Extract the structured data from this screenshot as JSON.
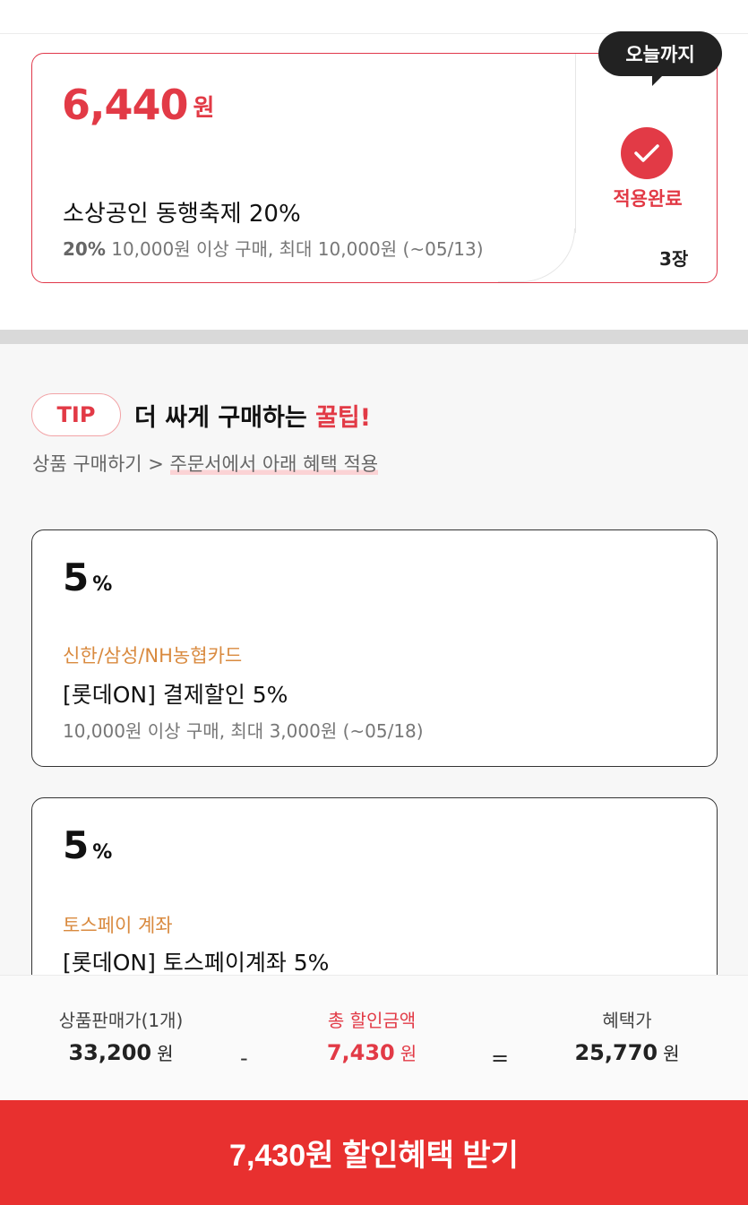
{
  "coupon": {
    "price": "6,440",
    "price_unit": "원",
    "title": "소상공인 동행축제 20%",
    "cond_rate": "20%",
    "cond_text": "10,000원 이상 구매, 최대 10,000원  (~05/13)",
    "today_badge": "오늘까지",
    "status": "적용완료",
    "count": "3장",
    "icons": {
      "check": "check-icon"
    }
  },
  "tip": {
    "badge": "TIP",
    "heading_prefix": "더 싸게 구매하는 ",
    "heading_highlight": "꿀팁!",
    "sub_prefix": "상품 구매하기 > ",
    "sub_highlight": "주문서에서 아래 혜택 적용"
  },
  "benefits": [
    {
      "percent": "5",
      "percent_symbol": "%",
      "provider": "신한/삼성/NH농협카드",
      "title": "[롯데ON] 결제할인 5%",
      "condition": "10,000원 이상 구매, 최대 3,000원 (~05/18)"
    },
    {
      "percent": "5",
      "percent_symbol": "%",
      "provider": "토스페이 계좌",
      "title": "[롯데ON] 토스페이계좌 5%"
    }
  ],
  "summary": {
    "price_label": "상품판매가(1개)",
    "price_value": "33,200",
    "minus": "-",
    "discount_label": "총 할인금액",
    "discount_value": "7,430",
    "equals": "=",
    "final_label": "혜택가",
    "final_value": "25,770",
    "unit": "원"
  },
  "cta": {
    "label": "7,430원 할인혜택 받기"
  },
  "colors": {
    "accent": "#e23a46",
    "cta": "#e8302f",
    "provider": "#d98a3f"
  }
}
